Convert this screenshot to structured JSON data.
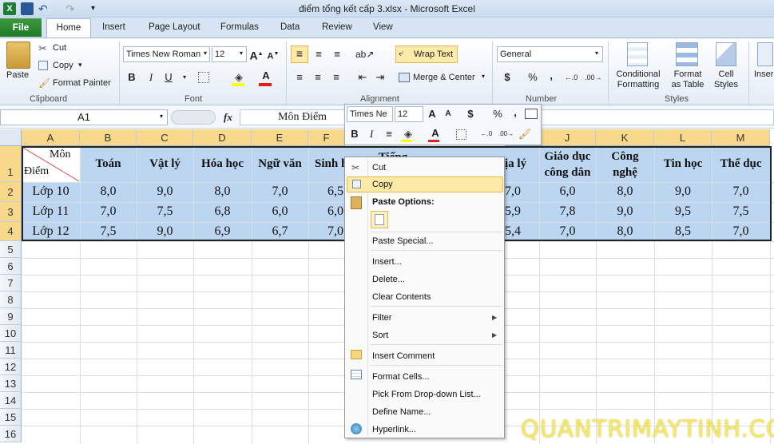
{
  "window": {
    "title": "điểm tổng kết cấp 3.xlsx  -  Microsoft Excel"
  },
  "tabs": [
    "File",
    "Home",
    "Insert",
    "Page Layout",
    "Formulas",
    "Data",
    "Review",
    "View"
  ],
  "clipboard": {
    "paste": "Paste",
    "cut": "Cut",
    "copy": "Copy",
    "format_painter": "Format Painter",
    "label": "Clipboard"
  },
  "font": {
    "name": "Times New Roman",
    "size": "12",
    "label": "Font",
    "bold": "B",
    "italic": "I",
    "underline": "U",
    "font_color": "A"
  },
  "alignment": {
    "wrap_text": "Wrap Text",
    "merge_center": "Merge & Center",
    "label": "Alignment"
  },
  "number": {
    "format": "General",
    "currency": "$",
    "percent": "%",
    "comma": ",",
    "label": "Number"
  },
  "styles": {
    "conditional": "Conditional\nFormatting",
    "format_table": "Format\nas Table",
    "cell_styles": "Cell\nStyles",
    "label": "Styles"
  },
  "insert_label": "Inser",
  "formula_bar": {
    "name_box": "A1",
    "fx": "fx",
    "value": "Môn Điểm"
  },
  "columns": [
    "A",
    "B",
    "C",
    "D",
    "E",
    "F",
    "G",
    "H",
    "I",
    "J",
    "K",
    "L",
    "M"
  ],
  "rows": [
    "1",
    "2",
    "3",
    "4",
    "5",
    "6",
    "7",
    "8",
    "9",
    "10",
    "11",
    "12",
    "13",
    "14",
    "15",
    "16"
  ],
  "sheet": {
    "a1_top": "Môn",
    "a1_bottom": "Điểm",
    "headers": [
      "Toán",
      "Vật lý",
      "Hóa học",
      "Ngữ văn",
      "Sinh h",
      "Tiếng",
      "",
      "ịa lý",
      "Giáo dục công dân",
      "Công nghệ",
      "Tin học",
      "Thể dục"
    ],
    "data": [
      [
        "Lớp 10",
        "8,0",
        "9,0",
        "8,0",
        "7,0",
        "6,5",
        "",
        "",
        "7,0",
        "6,0",
        "8,0",
        "9,0",
        "7,0"
      ],
      [
        "Lớp 11",
        "7,0",
        "7,5",
        "6,8",
        "6,0",
        "6,0",
        "",
        "",
        "5,9",
        "7,8",
        "9,0",
        "9,5",
        "7,5"
      ],
      [
        "Lớp 12",
        "7,5",
        "9,0",
        "6,9",
        "6,7",
        "7,0",
        "",
        "",
        "5,4",
        "7,0",
        "8,0",
        "8,5",
        "7,0"
      ]
    ]
  },
  "mini_toolbar": {
    "font": "Times Ne",
    "size": "12",
    "currency": "$",
    "percent": "%",
    "comma": ",",
    "bold": "B",
    "italic": "I"
  },
  "context_menu": {
    "cut": "Cut",
    "copy": "Copy",
    "paste_options": "Paste Options:",
    "paste_special": "Paste Special...",
    "insert": "Insert...",
    "delete": "Delete...",
    "clear_contents": "Clear Contents",
    "filter": "Filter",
    "sort": "Sort",
    "insert_comment": "Insert Comment",
    "format_cells": "Format Cells...",
    "pick_list": "Pick From Drop-down List...",
    "define_name": "Define Name...",
    "hyperlink": "Hyperlink..."
  },
  "watermark": "QUANTRIMAYTINH.COM",
  "colors": {
    "selection": "#bcd6f2",
    "file_tab": "#2a8a31",
    "highlight": "#fde9a8"
  }
}
